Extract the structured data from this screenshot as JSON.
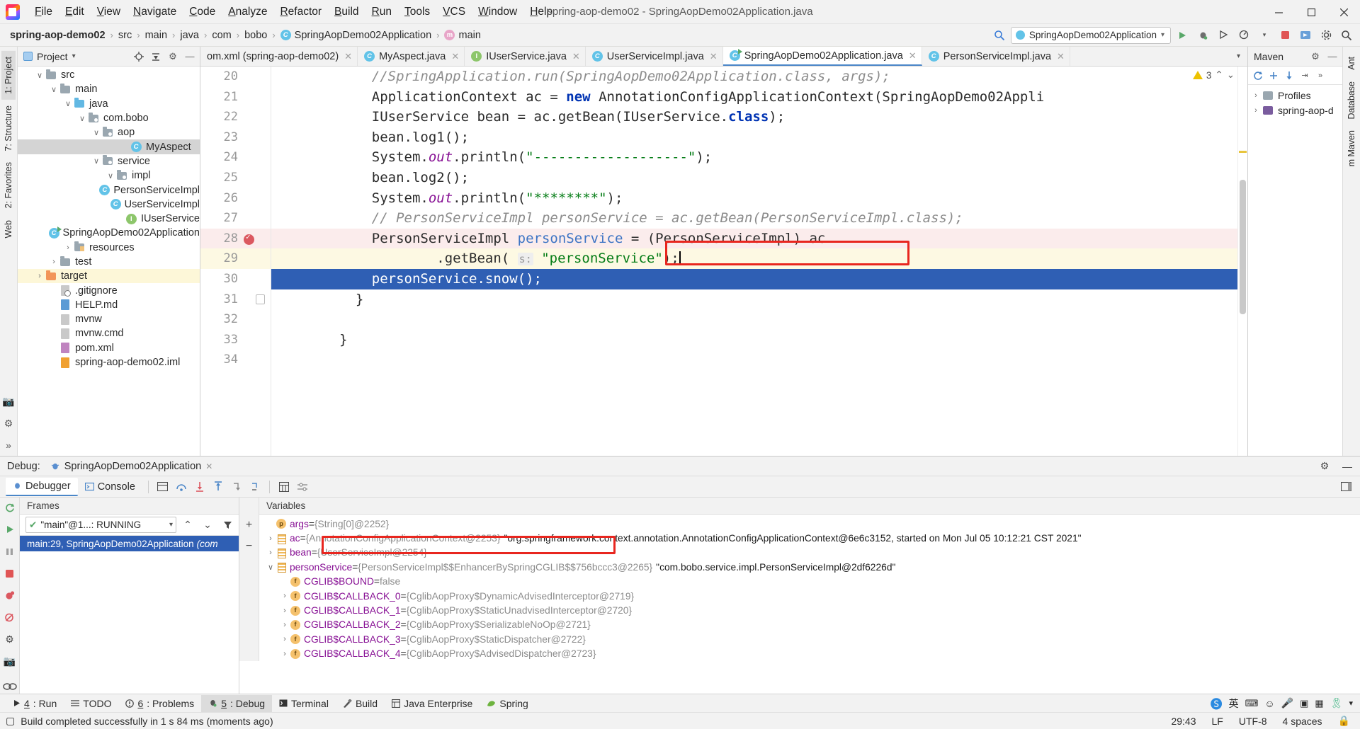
{
  "window": {
    "title": "spring-aop-demo02 - SpringAopDemo02Application.java",
    "minimize": "—",
    "maximize": "▢",
    "close": "✕"
  },
  "menu": [
    "File",
    "Edit",
    "View",
    "Navigate",
    "Code",
    "Analyze",
    "Refactor",
    "Build",
    "Run",
    "Tools",
    "VCS",
    "Window",
    "Help"
  ],
  "breadcrumb": {
    "items": [
      "spring-aop-demo02",
      "src",
      "main",
      "java",
      "com",
      "bobo",
      "SpringAopDemo02Application",
      "main"
    ],
    "separator": "›"
  },
  "run_config": {
    "name": "SpringAopDemo02Application",
    "chevron": "▾",
    "run_icon": "▶",
    "debug_icon": "🐞",
    "build_icon": "🔨",
    "coverage_icon": "▶",
    "stop_icon": "■",
    "search_icon": "🔍"
  },
  "left_rail": {
    "tabs": [
      "1: Project",
      "7: Structure",
      "2: Favorites",
      "Web"
    ],
    "icons": [
      "camera-icon",
      "gear-icon",
      "chevrons-icon"
    ]
  },
  "right_rail": {
    "tabs": [
      "Ant",
      "Database",
      "m Maven"
    ]
  },
  "project_pane": {
    "title": "Project",
    "chevron": "▾",
    "header_icons": [
      "locate-icon",
      "collapse-all-icon",
      "gear-icon",
      "hide-icon"
    ],
    "tree": [
      {
        "depth": 1,
        "arrow": "∨",
        "icon": "folder",
        "label": "src",
        "state": ""
      },
      {
        "depth": 2,
        "arrow": "∨",
        "icon": "folder",
        "label": "main",
        "state": ""
      },
      {
        "depth": 3,
        "arrow": "∨",
        "icon": "folder-blue",
        "label": "java",
        "state": ""
      },
      {
        "depth": 4,
        "arrow": "∨",
        "icon": "package",
        "label": "com.bobo",
        "state": ""
      },
      {
        "depth": 5,
        "arrow": "∨",
        "icon": "package",
        "label": "aop",
        "state": ""
      },
      {
        "depth": 7,
        "arrow": "",
        "icon": "class",
        "label": "MyAspect",
        "state": "selected"
      },
      {
        "depth": 5,
        "arrow": "∨",
        "icon": "package",
        "label": "service",
        "state": ""
      },
      {
        "depth": 6,
        "arrow": "∨",
        "icon": "package",
        "label": "impl",
        "state": ""
      },
      {
        "depth": 8,
        "arrow": "",
        "icon": "class",
        "label": "PersonServiceImpl",
        "state": ""
      },
      {
        "depth": 8,
        "arrow": "",
        "icon": "class",
        "label": "UserServiceImpl",
        "state": ""
      },
      {
        "depth": 7,
        "arrow": "",
        "icon": "interface",
        "label": "IUserService",
        "state": ""
      },
      {
        "depth": 6,
        "arrow": "",
        "icon": "class-run",
        "label": "SpringAopDemo02Application",
        "state": ""
      },
      {
        "depth": 3,
        "arrow": "›",
        "icon": "folder-res",
        "label": "resources",
        "state": ""
      },
      {
        "depth": 2,
        "arrow": "›",
        "icon": "folder",
        "label": "test",
        "state": ""
      },
      {
        "depth": 1,
        "arrow": "›",
        "icon": "folder-orange",
        "label": "target",
        "state": "highlight"
      },
      {
        "depth": 2,
        "arrow": "",
        "icon": "file-git",
        "label": ".gitignore",
        "state": ""
      },
      {
        "depth": 2,
        "arrow": "",
        "icon": "file-md",
        "label": "HELP.md",
        "state": ""
      },
      {
        "depth": 2,
        "arrow": "",
        "icon": "file",
        "label": "mvnw",
        "state": ""
      },
      {
        "depth": 2,
        "arrow": "",
        "icon": "file",
        "label": "mvnw.cmd",
        "state": ""
      },
      {
        "depth": 2,
        "arrow": "",
        "icon": "file-m",
        "label": "pom.xml",
        "state": ""
      },
      {
        "depth": 2,
        "arrow": "",
        "icon": "file-xml",
        "label": "spring-aop-demo02.iml",
        "state": ""
      }
    ]
  },
  "editor": {
    "tabs": [
      {
        "label": "om.xml (spring-aop-demo02)",
        "icon": "none",
        "active": false,
        "closable": true
      },
      {
        "label": "MyAspect.java",
        "icon": "class",
        "active": false,
        "closable": true
      },
      {
        "label": "IUserService.java",
        "icon": "interface",
        "active": false,
        "closable": true
      },
      {
        "label": "UserServiceImpl.java",
        "icon": "class",
        "active": false,
        "closable": true
      },
      {
        "label": "SpringAopDemo02Application.java",
        "icon": "class-run",
        "active": true,
        "closable": true
      },
      {
        "label": "PersonServiceImpl.java",
        "icon": "class",
        "active": false,
        "closable": true
      }
    ],
    "tab_chevron": "▾",
    "warnings": {
      "count": "3",
      "up": "⌃",
      "down": "⌄"
    },
    "lines": [
      {
        "n": "20",
        "state": "",
        "html": "    <span class='cmt'>//SpringApplication.run(SpringAopDemo02Application.class, args);</span>"
      },
      {
        "n": "21",
        "state": "",
        "html": "    ApplicationContext ac = <span class='kw'>new</span> AnnotationConfigApplicationContext(SpringAopDemo02Appli"
      },
      {
        "n": "22",
        "state": "",
        "html": "    IUserService bean = ac.getBean(IUserService.<span class='kw'>class</span>);"
      },
      {
        "n": "23",
        "state": "",
        "html": "    bean.log1();"
      },
      {
        "n": "24",
        "state": "",
        "html": "    System.<span class='fld'>out</span>.println(<span class='str'>\"-------------------\"</span>);"
      },
      {
        "n": "25",
        "state": "",
        "html": "    bean.log2();"
      },
      {
        "n": "26",
        "state": "",
        "html": "    System.<span class='fld'>out</span>.println(<span class='str'>\"********\"</span>);"
      },
      {
        "n": "27",
        "state": "",
        "html": "    <span class='cmt'>// PersonServiceImpl personService = ac.getBean(PersonServiceImpl.class);</span>"
      },
      {
        "n": "28",
        "state": "err",
        "html": "    PersonServiceImpl <span class='var'>personService</span> = (PersonServiceImpl) ac"
      },
      {
        "n": "29",
        "state": "cur",
        "html": "            .getBean( <span class='hint'>s:</span> <span class='str'>\"personService\"</span>);<span class='caret'></span>"
      },
      {
        "n": "30",
        "state": "selblue",
        "html": "    personService.snow();"
      },
      {
        "n": "31",
        "state": "",
        "html": "  }"
      },
      {
        "n": "32",
        "state": "",
        "html": ""
      },
      {
        "n": "33",
        "state": "",
        "html": "}"
      },
      {
        "n": "34",
        "state": "",
        "html": ""
      }
    ],
    "breakpoint_line": "28"
  },
  "maven": {
    "title": "Maven",
    "gear": "gear-icon",
    "toolbar_icons": [
      "refresh-icon",
      "add-icon",
      "download-icon",
      "collapse-icon",
      "more-icon"
    ],
    "items": [
      {
        "arrow": "›",
        "label": "Profiles",
        "icon": "profiles-icon"
      },
      {
        "arrow": "›",
        "label": "spring-aop-d",
        "icon": "maven-project-icon"
      }
    ]
  },
  "debug": {
    "label": "Debug:",
    "session": "SpringAopDemo02Application",
    "session_close": "✕",
    "settings_icon": "gear-icon",
    "hide_icon": "—",
    "tabs": [
      {
        "label": "Debugger",
        "icon": "debugger-icon",
        "active": true
      },
      {
        "label": "Console",
        "icon": "console-icon",
        "active": false
      }
    ],
    "toolbar_icons": [
      "layout-icon",
      "step-over-icon",
      "step-into-icon",
      "force-step-into-icon",
      "step-out-icon",
      "drop-frame-icon",
      "run-to-cursor-icon",
      "evaluate-icon",
      "settings-icon"
    ],
    "rail_icons": [
      "rerun-icon",
      "resume-icon",
      "pause-icon",
      "stop-icon",
      "mute-icon",
      "view-breakpoints-icon",
      "settings-icon",
      "camera-icon"
    ],
    "frames": {
      "header": "Frames",
      "thread": "\"main\"@1...: RUNNING",
      "thread_chevron": "▾",
      "nav": [
        "⌃",
        "⌄",
        "filter-icon"
      ],
      "rows": [
        {
          "label": "main:29, SpringAopDemo02Application",
          "suffix": "(com",
          "selected": true
        }
      ]
    },
    "variables": {
      "header": "Variables",
      "buttons": [
        "+",
        "−"
      ],
      "rows": [
        {
          "indent": 0,
          "arrow": "",
          "badge": "p",
          "badge_type": "param",
          "name": "args",
          "eq": " = ",
          "value": "{String[0]@2252}",
          "extra": "",
          "boxed": false
        },
        {
          "indent": 0,
          "arrow": "›",
          "badge": "",
          "badge_type": "list",
          "name": "ac",
          "eq": " = ",
          "value": "{AnnotationConfigApplicationContext@2253}",
          "extra": "\"org.springframework.context.annotation.AnnotationConfigApplicationContext@6e6c3152, started on Mon Jul 05 10:12:21 CST 2021\"",
          "boxed": false
        },
        {
          "indent": 0,
          "arrow": "›",
          "badge": "",
          "badge_type": "list",
          "name": "bean",
          "eq": " = ",
          "value": "{UserServiceImpl@2254}",
          "extra": "",
          "boxed": false
        },
        {
          "indent": 0,
          "arrow": "∨",
          "badge": "",
          "badge_type": "list",
          "name": "personService",
          "eq": " = ",
          "value": "{PersonServiceImpl$$EnhancerBySpringCGLIB$$756bccc3@2265}",
          "extra": "\"com.bobo.service.impl.PersonServiceImpl@2df6226d\"",
          "boxed": true
        },
        {
          "indent": 1,
          "arrow": "",
          "badge": "f",
          "badge_type": "field",
          "name": "CGLIB$BOUND",
          "eq": " = ",
          "value": "false",
          "extra": "",
          "boxed": false
        },
        {
          "indent": 1,
          "arrow": "›",
          "badge": "f",
          "badge_type": "field",
          "name": "CGLIB$CALLBACK_0",
          "eq": " = ",
          "value": "{CglibAopProxy$DynamicAdvisedInterceptor@2719}",
          "extra": "",
          "boxed": false
        },
        {
          "indent": 1,
          "arrow": "›",
          "badge": "f",
          "badge_type": "field",
          "name": "CGLIB$CALLBACK_1",
          "eq": " = ",
          "value": "{CglibAopProxy$StaticUnadvisedInterceptor@2720}",
          "extra": "",
          "boxed": false
        },
        {
          "indent": 1,
          "arrow": "›",
          "badge": "f",
          "badge_type": "field",
          "name": "CGLIB$CALLBACK_2",
          "eq": " = ",
          "value": "{CglibAopProxy$SerializableNoOp@2721}",
          "extra": "",
          "boxed": false
        },
        {
          "indent": 1,
          "arrow": "›",
          "badge": "f",
          "badge_type": "field",
          "name": "CGLIB$CALLBACK_3",
          "eq": " = ",
          "value": "{CglibAopProxy$StaticDispatcher@2722}",
          "extra": "",
          "boxed": false
        },
        {
          "indent": 1,
          "arrow": "›",
          "badge": "f",
          "badge_type": "field",
          "name": "CGLIB$CALLBACK_4",
          "eq": " = ",
          "value": "{CglibAopProxy$AdvisedDispatcher@2723}",
          "extra": "",
          "boxed": false
        }
      ]
    }
  },
  "toolwindow_bar": {
    "items": [
      {
        "num": "4",
        "label": ": Run",
        "icon": "run-icon",
        "active": false
      },
      {
        "num": "",
        "label": "TODO",
        "icon": "todo-icon",
        "active": false
      },
      {
        "num": "6",
        "label": ": Problems",
        "icon": "problems-icon",
        "active": false
      },
      {
        "num": "5",
        "label": ": Debug",
        "icon": "debug-icon",
        "active": true
      },
      {
        "num": "",
        "label": "Terminal",
        "icon": "terminal-icon",
        "active": false
      },
      {
        "num": "",
        "label": "Build",
        "icon": "build-icon",
        "active": false
      },
      {
        "num": "",
        "label": "Java Enterprise",
        "icon": "java-enterprise-icon",
        "active": false
      },
      {
        "num": "",
        "label": "Spring",
        "icon": "spring-icon",
        "active": false
      }
    ],
    "tray": [
      "sogou-icon",
      "lang-icon",
      "keyboard-icon",
      "smiley-icon",
      "mic-icon",
      "screen-icon",
      "grid-icon",
      "ribbon-icon",
      "chevron-icon"
    ]
  },
  "statusbar": {
    "message": "Build completed successfully in 1 s 84 ms (moments ago)",
    "caret": "29:43",
    "line_sep": "LF",
    "encoding": "UTF-8",
    "indent": "4 spaces",
    "lock_icon": "lock-icon"
  },
  "colors": {
    "accent": "#4a86c8",
    "selection": "#2f5fb4",
    "error_box": "#e8261f",
    "keyword": "#0033b3",
    "string": "#067d17",
    "comment": "#8c8c8c"
  }
}
